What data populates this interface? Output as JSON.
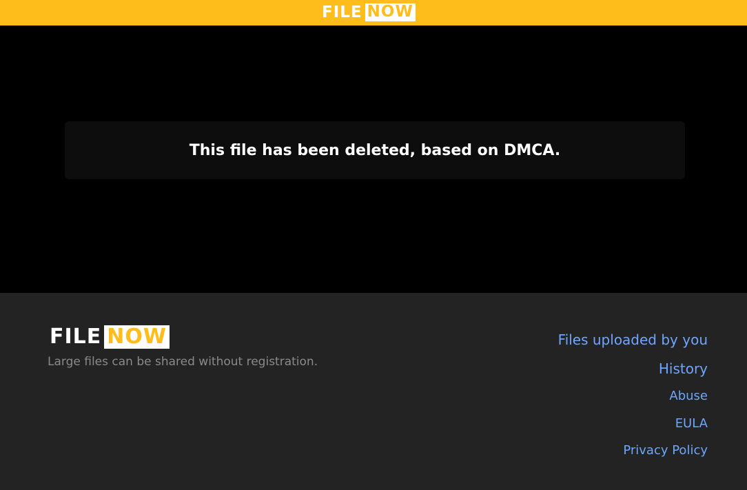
{
  "header": {
    "logo": {
      "file": "FILE",
      "now": "NOW"
    }
  },
  "main": {
    "notice": "This file has been deleted, based on DMCA."
  },
  "footer": {
    "logo": {
      "file": "FILE",
      "now": "NOW"
    },
    "tagline": "Large files can be shared without registration.",
    "links": [
      {
        "label": "Files uploaded by you"
      },
      {
        "label": "History"
      },
      {
        "label": "Abuse"
      },
      {
        "label": "EULA"
      },
      {
        "label": "Privacy Policy"
      }
    ]
  },
  "colors": {
    "brand_yellow": "#ffbd1b",
    "footer_bg": "#232323",
    "notice_bg": "#0d0d0d",
    "link": "#6ea6ff",
    "tagline": "#8a8a8a"
  }
}
